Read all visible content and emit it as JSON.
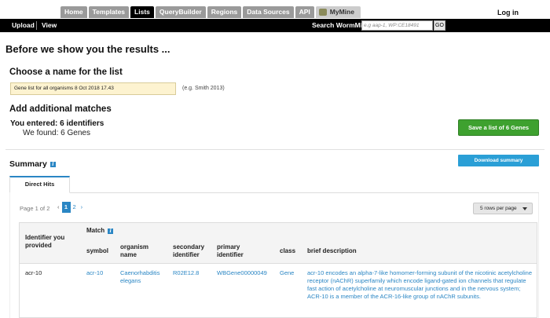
{
  "nav": {
    "tabs": [
      "Home",
      "Templates",
      "Lists",
      "QueryBuilder",
      "Regions",
      "Data Sources",
      "API"
    ],
    "active_tab": "Lists",
    "mymine_label": "MyMine",
    "login_label": "Log in"
  },
  "subnav": {
    "upload_label": "Upload",
    "view_label": "View",
    "search_label": "Search WormMine",
    "search_placeholder": "e.g aap-1, WP:CE18491",
    "go_label": "GO"
  },
  "page": {
    "title": "Before we show you the results ...",
    "name_heading": "Choose a name for the list",
    "list_name_value": "Gene list for all organisms 8 Oct 2018 17.43",
    "name_hint": "(e.g. Smith 2013)",
    "additional_heading": "Add additional matches",
    "entered_text": "You entered: 6 identifiers",
    "found_text": "We found: 6 Genes",
    "save_button": "Save a list of 6 Genes"
  },
  "summary": {
    "title": "Summary",
    "download_button": "Download summary",
    "tab_label": "Direct Hits",
    "page_label": "Page 1 of 2",
    "prev": "‹",
    "pages": [
      "1",
      "2"
    ],
    "current_page": "1",
    "next": "›",
    "rows_per_page": "5 rows per page"
  },
  "table": {
    "identifier_header": "Identifier you provided",
    "match_header": "Match",
    "columns": [
      "symbol",
      "organism name",
      "secondary identifier",
      "primary identifier",
      "class",
      "brief description"
    ],
    "rows": [
      {
        "identifier": "acr-10",
        "symbol": "acr-10",
        "organism": "Caenorhabditis elegans",
        "secondary": "R02E12.8",
        "primary": "WBGene00000049",
        "class": "Gene",
        "description": "acr-10 encodes an alpha-7-like homomer-forming subunit of the nicotinic acetylcholine receptor (nAChR) superfamily which encode ligand-gated ion channels that regulate fast action of acetylcholine at neuromuscular junctions and in the nervous system; ACR-10 is a member of the ACR-16-like group of nAChR subunits."
      }
    ]
  },
  "colors": {
    "nav_tab": "#9a9a9a",
    "nav_active": "#000000",
    "save_green": "#3ea12f",
    "accent_blue": "#2a86c4",
    "download_blue": "#2a9fd6",
    "name_input_bg": "#fdf3d0"
  }
}
